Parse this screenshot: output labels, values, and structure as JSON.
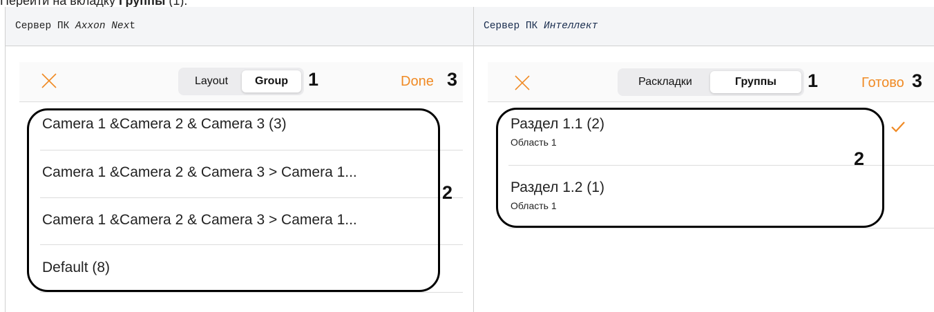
{
  "intro": {
    "prefix": "Перейти на вкладку ",
    "bold": "Группы",
    "suffix": " (1)."
  },
  "left": {
    "header_prefix": "Сервер ПК ",
    "header_italic": "Axxon Nex",
    "header_suffix": "t",
    "seg_tabs": [
      "Layout",
      "Group"
    ],
    "active_tab": "Group",
    "done_label": "Done",
    "marker_tabs": "1",
    "marker_list": "2",
    "marker_done": "3",
    "rows": [
      {
        "title": "Camera 1 &Camera 2 & Camera 3 (3)"
      },
      {
        "title": "Camera 1 &Camera 2 & Camera 3 > Camera 1..."
      },
      {
        "title": "Camera 1 &Camera 2 & Camera 3 > Camera 1..."
      },
      {
        "title": "Default (8)"
      }
    ]
  },
  "right": {
    "header_prefix": "Сервер ПК ",
    "header_italic": "Интеллект",
    "seg_tabs": [
      "Раскладки",
      "Группы"
    ],
    "active_tab": "Группы",
    "done_label": "Готово",
    "marker_tabs": "1",
    "marker_list": "2",
    "marker_done": "3",
    "rows": [
      {
        "title": "Раздел 1.1 (2)",
        "subtitle": "Область 1",
        "checked": true
      },
      {
        "title": "Раздел 1.2 (1)",
        "subtitle": "Область 1",
        "checked": false
      }
    ]
  },
  "colors": {
    "accent": "#f08a24",
    "frame": "#000000",
    "header_bg": "#f4f5f7"
  },
  "icons": {
    "close": "close-icon",
    "check": "checkmark-icon"
  }
}
